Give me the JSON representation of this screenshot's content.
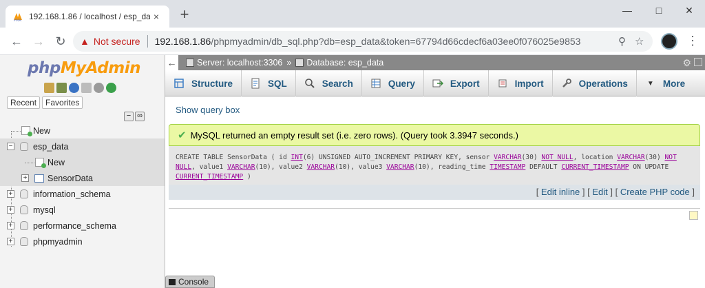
{
  "browser": {
    "tab_title": "192.168.1.86 / localhost / esp_da",
    "tab_close": "×",
    "new_tab": "+",
    "security_label": "Not secure",
    "url_host": "192.168.1.86",
    "url_path": "/phpmyadmin/db_sql.php?db=esp_data&token=67794d66cdecf6a03ee0f076025e9853"
  },
  "nav": {
    "logo_php": "php",
    "logo_myadmin": "MyAdmin",
    "tabs": [
      "Recent",
      "Favorites"
    ],
    "tree": {
      "new_root": "New",
      "selected_db": "esp_data",
      "db_new": "New",
      "table": "SensorData",
      "databases": [
        "information_schema",
        "mysql",
        "performance_schema",
        "phpmyadmin"
      ]
    }
  },
  "main": {
    "breadcrumb": {
      "server": "Server: localhost:3306",
      "separator": "»",
      "database": "Database: esp_data"
    },
    "menu": [
      "Structure",
      "SQL",
      "Search",
      "Query",
      "Export",
      "Import",
      "Operations",
      "More"
    ],
    "show_query_box": "Show query box",
    "success_message": "MySQL returned an empty result set (i.e. zero rows). (Query took 3.3947 seconds.)",
    "sql": {
      "t1": "CREATE TABLE SensorData ( id ",
      "k1": "INT",
      "t2": "(6) UNSIGNED AUTO_INCREMENT PRIMARY KEY, sensor ",
      "k2": "VARCHAR",
      "t3": "(30) ",
      "k3": "NOT NULL",
      "t4": ", location ",
      "k4": "VARCHAR",
      "t5": "(30) ",
      "k5": "NOT NULL",
      "t6": ", value1 ",
      "k6": "VARCHAR",
      "t7": "(10), value2 ",
      "k7": "VARCHAR",
      "t8": "(10), value3 ",
      "k8": "VARCHAR",
      "t9": "(10), reading_time ",
      "k9": "TIMESTAMP",
      "t10": " DEFAULT ",
      "k10": "CURRENT_TIMESTAMP",
      "t11": " ON UPDATE ",
      "k11": "CURRENT_TIMESTAMP",
      "t12": " )"
    },
    "edit_links": {
      "edit_inline": "Edit inline",
      "edit": "Edit",
      "create_php": "Create PHP code"
    },
    "console_label": "Console"
  }
}
